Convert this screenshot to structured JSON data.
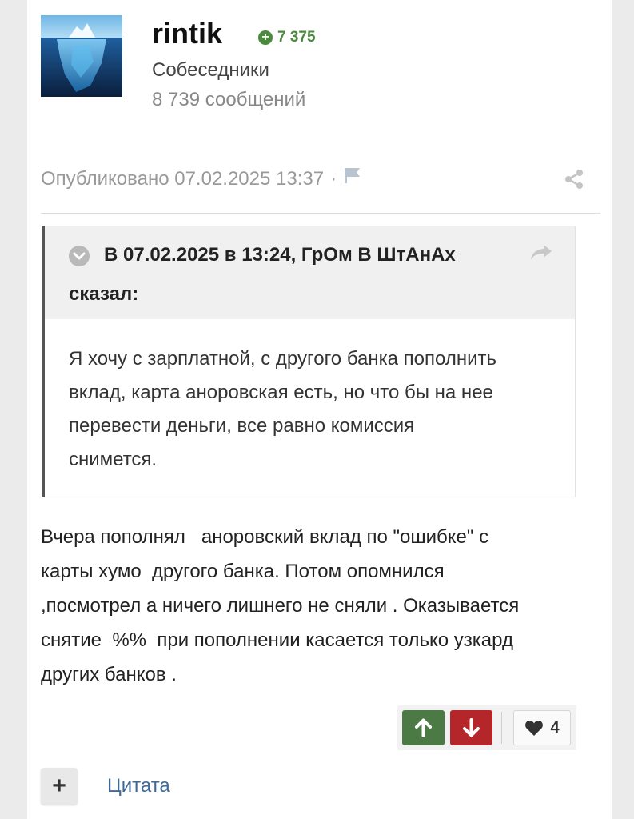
{
  "author": {
    "name": "rintik",
    "reputation": "7 375",
    "group": "Собеседники",
    "post_count": "8 739 сообщений"
  },
  "post": {
    "published": "Опубликовано 07.02.2025 13:37",
    "separator": "·",
    "quote": {
      "citation_line1": "В 07.02.2025 в 13:24, ГрОм В ШтАнАх",
      "citation_line2": "сказал:",
      "lines": [
        "Я хочу с зарплатной, с другого банка пополнить",
        "вклад,  карта аноровская есть, но что бы на нее",
        "перевести деньги, все равно комиссия",
        "снимется."
      ]
    },
    "body_lines": [
      "Вчера пополнял   аноровский вклад по \"ошибке\" с",
      "карты хумо  другого банка. Потом опомнился",
      ",посмотрел а ничего лишнего не сняли . Оказывается",
      "снятие  %%  при пополнении касается только узкард",
      "других банков ."
    ]
  },
  "reactions": {
    "like_count": "4"
  },
  "actions": {
    "plus_label": "+",
    "quote_label": "Цитата"
  },
  "colors": {
    "upvote": "#4b7a45",
    "downvote": "#b5262b",
    "reputation": "#4a8a3c",
    "link": "#3e6a9a"
  },
  "icons": [
    "iceberg-avatar",
    "plus-circle-icon",
    "flag-icon",
    "share-icon",
    "chevron-down-icon",
    "reply-arrow-icon",
    "arrow-up-icon",
    "arrow-down-icon",
    "heart-icon"
  ]
}
